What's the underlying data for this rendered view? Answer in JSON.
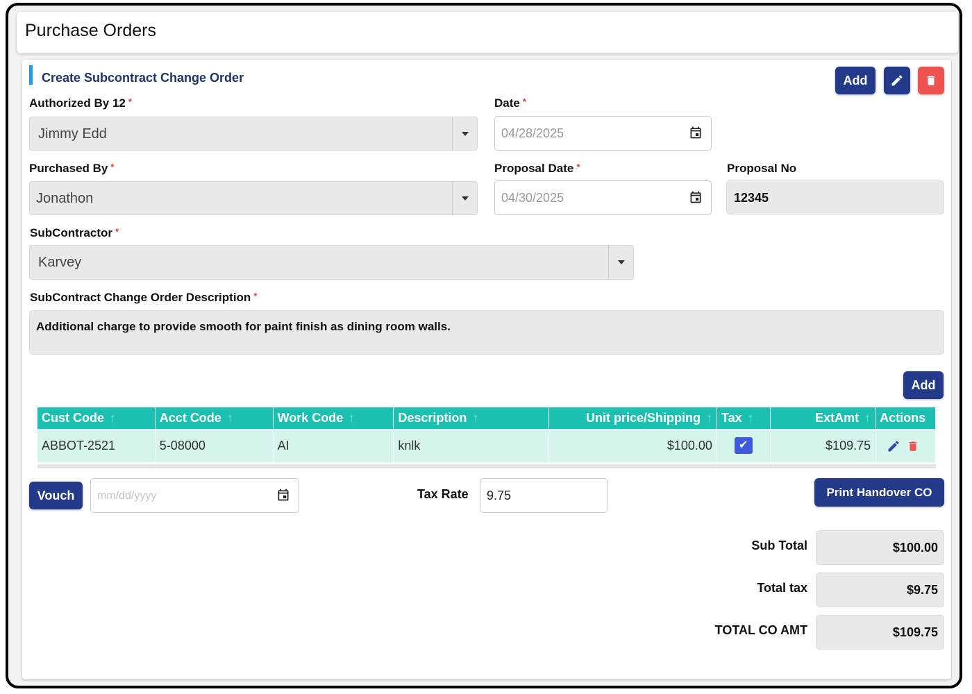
{
  "page": {
    "title": "Purchase Orders"
  },
  "form": {
    "section_title": "Create Subcontract Change Order",
    "header_buttons": {
      "add": "Add",
      "edit_icon": "pencil-icon",
      "delete_icon": "trash-icon"
    },
    "authorized_by": {
      "label": "Authorized By 12",
      "required": "*",
      "value": "Jimmy Edd"
    },
    "date": {
      "label": "Date",
      "required": "*",
      "value": "04/28/2025"
    },
    "purchased_by": {
      "label": "Purchased By",
      "required": "*",
      "value": "Jonathon"
    },
    "proposal_date": {
      "label": "Proposal Date",
      "required": "*",
      "value": "04/30/2025"
    },
    "proposal_no": {
      "label": "Proposal No",
      "value": "12345"
    },
    "subcontractor": {
      "label": "SubContractor",
      "required": "*",
      "value": "Karvey"
    },
    "description": {
      "label": "SubContract Change Order Description",
      "required": "*",
      "value": "Additional charge to provide smooth for paint finish as dining room walls."
    }
  },
  "table": {
    "add_label": "Add",
    "columns": [
      "Cust Code",
      "Acct Code",
      "Work Code",
      "Description",
      "Unit price/Shipping",
      "Tax",
      "ExtAmt",
      "Actions"
    ],
    "rows": [
      {
        "cust_code": "ABBOT-2521",
        "acct_code": "5-08000",
        "work_code": "AI",
        "description": "knlk",
        "unit_price": "$100.00",
        "tax_checked": true,
        "ext_amt": "$109.75"
      }
    ]
  },
  "footer": {
    "vouch_label": "Vouch",
    "vouch_date_placeholder": "mm/dd/yyyy",
    "tax_rate_label": "Tax Rate",
    "tax_rate_value": "9.75",
    "print_label": "Print Handover CO",
    "sub_total": {
      "label": "Sub Total",
      "value": "$100.00"
    },
    "total_tax": {
      "label": "Total tax",
      "value": "$9.75"
    },
    "total_co_amt": {
      "label": "TOTAL CO AMT",
      "value": "$109.75"
    }
  },
  "colors": {
    "primary": "#233a8a",
    "danger": "#ef5350",
    "table_header": "#1cc0b0",
    "table_row": "#d5f4ee",
    "accent_bar": "#1e9be6"
  }
}
